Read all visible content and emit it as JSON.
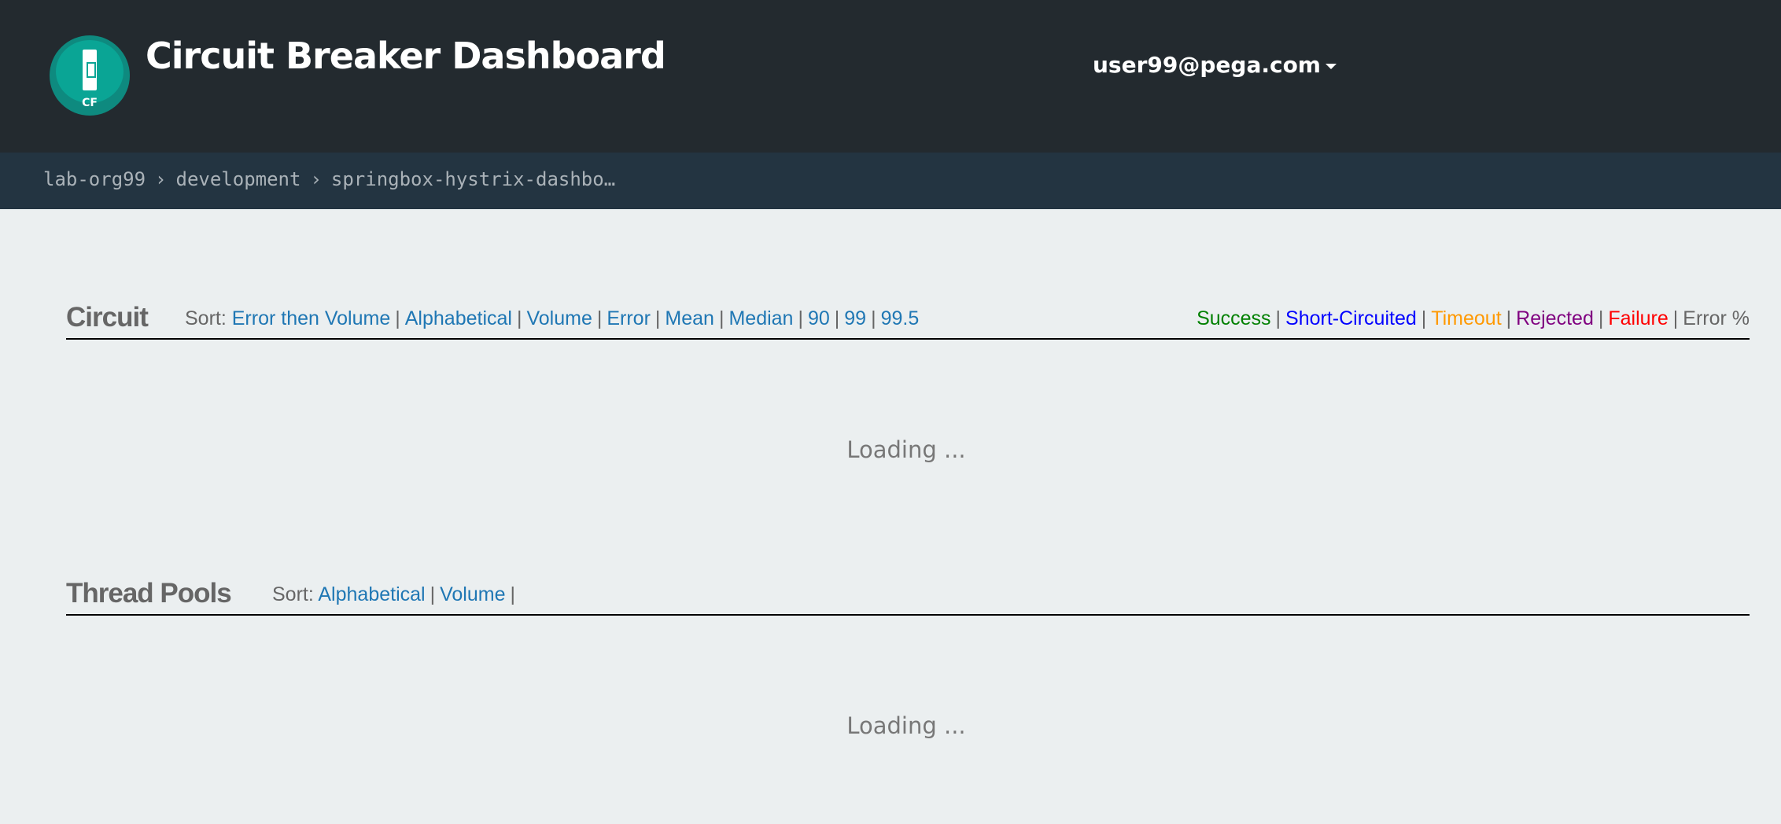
{
  "header": {
    "title": "Circuit Breaker Dashboard",
    "logo_text": "CF",
    "user": "user99@pega.com"
  },
  "breadcrumb": [
    "lab-org99",
    "development",
    "springbox-hystrix-dashbo…"
  ],
  "circuit": {
    "title": "Circuit",
    "sort_label": "Sort:",
    "sort_options": [
      "Error then Volume",
      "Alphabetical",
      "Volume",
      "Error",
      "Mean",
      "Median",
      "90",
      "99",
      "99.5"
    ],
    "legend": [
      {
        "label": "Success",
        "color": "#008000"
      },
      {
        "label": "Short-Circuited",
        "color": "#0000ff"
      },
      {
        "label": "Timeout",
        "color": "#ff9900"
      },
      {
        "label": "Rejected",
        "color": "#800080"
      },
      {
        "label": "Failure",
        "color": "#ff0000"
      },
      {
        "label": "Error %",
        "color": "#666666"
      }
    ],
    "loading": "Loading ..."
  },
  "thread_pools": {
    "title": "Thread Pools",
    "sort_label": "Sort:",
    "sort_options": [
      "Alphabetical",
      "Volume"
    ],
    "loading": "Loading ..."
  }
}
